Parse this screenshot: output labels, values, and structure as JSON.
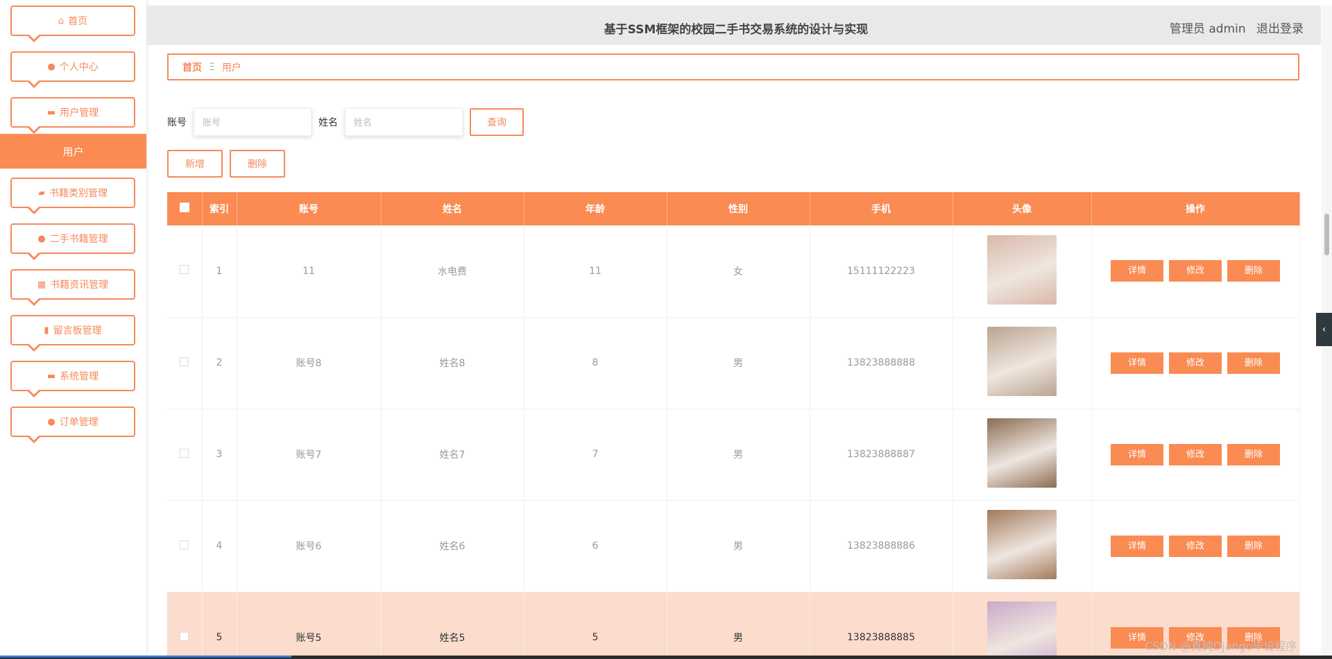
{
  "app": {
    "title": "基于SSM框架的校园二手书交易系统的设计与实现",
    "role": "管理员 admin",
    "logout": "退出登录"
  },
  "sidebar": {
    "items": [
      {
        "label": "首页",
        "icon": "home-icon",
        "glyph": "⌂"
      },
      {
        "label": "个人中心",
        "icon": "user-icon",
        "glyph": "●"
      },
      {
        "label": "用户管理",
        "icon": "folder-icon",
        "glyph": "▬"
      },
      {
        "label": "书籍类别管理",
        "icon": "ticket-icon",
        "glyph": "▰"
      },
      {
        "label": "二手书籍管理",
        "icon": "user-icon",
        "glyph": "●"
      },
      {
        "label": "书籍资讯管理",
        "icon": "grid-icon",
        "glyph": "▦"
      },
      {
        "label": "留言板管理",
        "icon": "thumb-icon",
        "glyph": "▮"
      },
      {
        "label": "系统管理",
        "icon": "briefcase-icon",
        "glyph": "▬"
      },
      {
        "label": "订单管理",
        "icon": "user-icon",
        "glyph": "●"
      }
    ],
    "active_sub": "用户"
  },
  "breadcrumb": {
    "home": "首页",
    "sep": "Ξ",
    "current": "用户"
  },
  "search": {
    "account_label": "账号",
    "account_placeholder": "账号",
    "name_label": "姓名",
    "name_placeholder": "姓名",
    "query": "查询"
  },
  "actions": {
    "add": "新增",
    "delete": "删除"
  },
  "table": {
    "columns": [
      "索引",
      "账号",
      "姓名",
      "年龄",
      "性别",
      "手机",
      "头像",
      "操作"
    ],
    "rows": [
      {
        "index": "1",
        "account": "11",
        "name": "水电费",
        "age": "11",
        "gender": "女",
        "phone": "15111122223",
        "avatar_color": "#d9b8a8"
      },
      {
        "index": "2",
        "account": "账号8",
        "name": "姓名8",
        "age": "8",
        "gender": "男",
        "phone": "13823888888",
        "avatar_color": "#b9a48f"
      },
      {
        "index": "3",
        "account": "账号7",
        "name": "姓名7",
        "age": "7",
        "gender": "男",
        "phone": "13823888887",
        "avatar_color": "#8a6c52"
      },
      {
        "index": "4",
        "account": "账号6",
        "name": "姓名6",
        "age": "6",
        "gender": "男",
        "phone": "13823888886",
        "avatar_color": "#a27a5b"
      },
      {
        "index": "5",
        "account": "账号5",
        "name": "姓名5",
        "age": "5",
        "gender": "男",
        "phone": "13823888885",
        "avatar_color": "#c9a9c8"
      }
    ],
    "ops": {
      "detail": "详情",
      "edit": "修改",
      "delete": "删除"
    }
  },
  "watermark": "CSDN @真纯Django毕设程序",
  "colors": {
    "accent": "#f98b53",
    "highlight_row": "#fcdccd"
  }
}
